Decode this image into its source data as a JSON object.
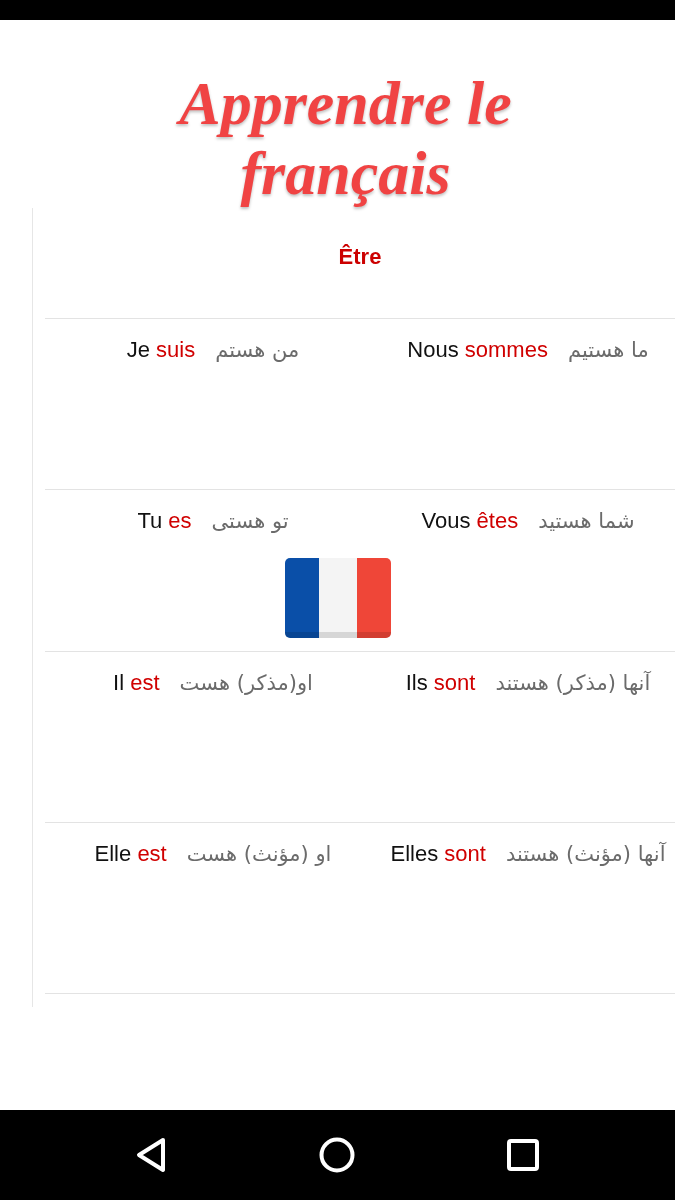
{
  "header": {
    "title": "Apprendre le français"
  },
  "lesson": {
    "verb": "Être"
  },
  "rows": [
    {
      "cells": [
        {
          "translation": "ما هستیم",
          "pronoun": "Nous",
          "verb": "sommes"
        },
        {
          "translation": "من هستم",
          "pronoun": "Je",
          "verb": "suis"
        }
      ]
    },
    {
      "cells": [
        {
          "translation": "شما هستید",
          "pronoun": "Vous",
          "verb": "êtes"
        },
        {
          "translation": "تو هستی",
          "pronoun": "Tu",
          "verb": "es"
        }
      ]
    },
    {
      "cells": [
        {
          "translation": "آنها (مذکر) هستند",
          "pronoun": "Ils",
          "verb": "sont"
        },
        {
          "translation": "او(مذکر) هست",
          "pronoun": "Il",
          "verb": "est"
        }
      ]
    },
    {
      "cells": [
        {
          "translation": "آنها (مؤنث) هستند",
          "pronoun": "Elles",
          "verb": "sont"
        },
        {
          "translation": "او (مؤنث) هست",
          "pronoun": "Elle",
          "verb": "est"
        }
      ]
    }
  ]
}
